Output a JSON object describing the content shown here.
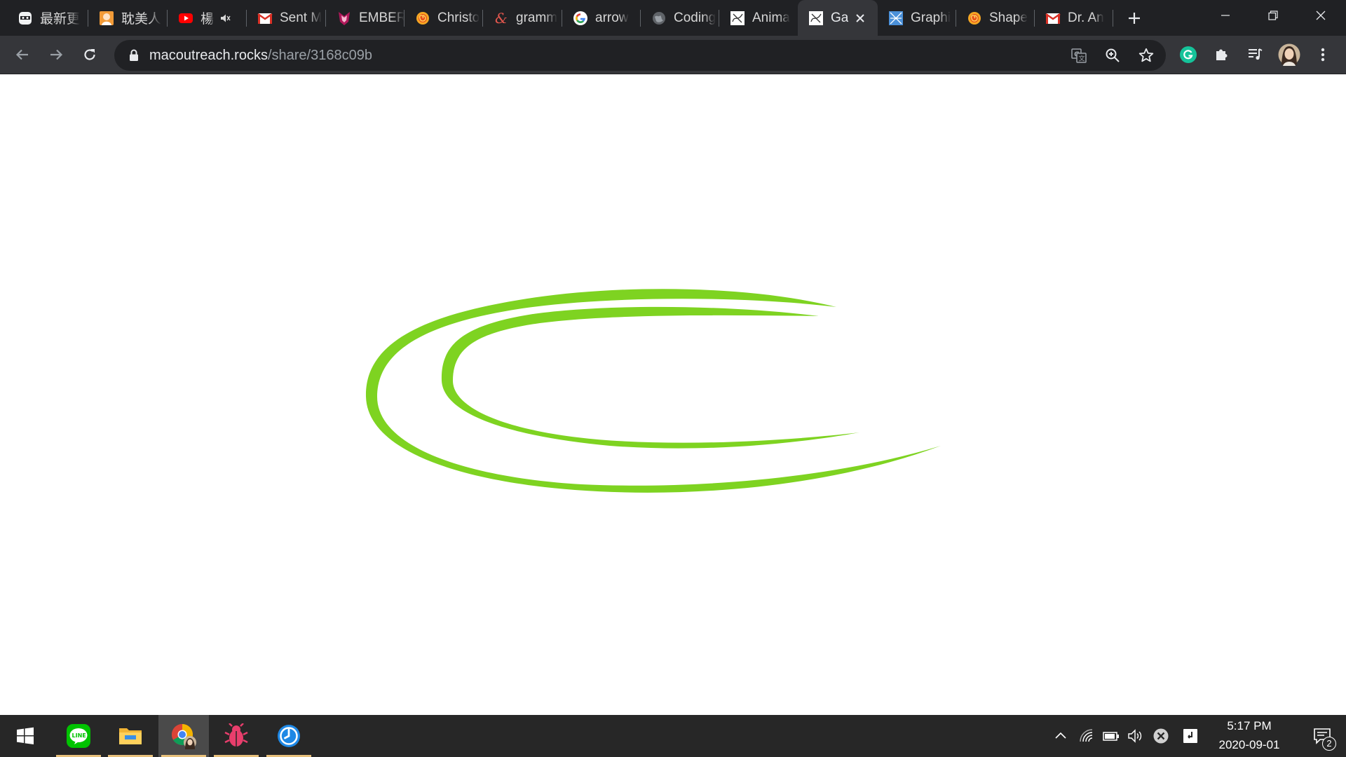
{
  "browser": {
    "tabs": [
      {
        "title": "最新更",
        "icon": "ninja-icon",
        "active": false
      },
      {
        "title": "耽美人",
        "icon": "anime-avatar-icon",
        "active": false
      },
      {
        "title": "楊",
        "icon": "youtube-icon",
        "active": false,
        "muted": true
      },
      {
        "title": "Sent M",
        "icon": "gmail-icon",
        "active": false
      },
      {
        "title": "EMBER",
        "icon": "ember-icon",
        "active": false
      },
      {
        "title": "Christo",
        "icon": "swirl-sun-icon",
        "active": false
      },
      {
        "title": "gramm",
        "icon": "ampersand-icon",
        "active": false
      },
      {
        "title": "arrow",
        "icon": "google-icon",
        "active": false
      },
      {
        "title": "Coding",
        "icon": "globe-icon",
        "active": false
      },
      {
        "title": "Anima",
        "icon": "sketch-icon",
        "active": false
      },
      {
        "title": "Ga",
        "icon": "sketch-icon",
        "active": true
      },
      {
        "title": "Graphi",
        "icon": "graphic-icon",
        "active": false
      },
      {
        "title": "Shape",
        "icon": "swirl-sun-icon",
        "active": false
      },
      {
        "title": "Dr. An",
        "icon": "gmail-icon",
        "active": false
      }
    ],
    "url_host": "macoutreach.rocks",
    "url_path": "/share/3168c09b"
  },
  "page": {
    "arc_color": "#7ed321"
  },
  "taskbar": {
    "apps": [
      "line-app",
      "file-explorer-app",
      "chrome-app",
      "bug-app",
      "clock-app"
    ],
    "time": "5:17 PM",
    "date": "2020-09-01",
    "notification_count": "2"
  },
  "colors": {
    "tabstrip_bg": "#202124",
    "toolbar_bg": "#35363a",
    "taskbar_bg": "#272727",
    "accent_green": "#7ed321"
  }
}
